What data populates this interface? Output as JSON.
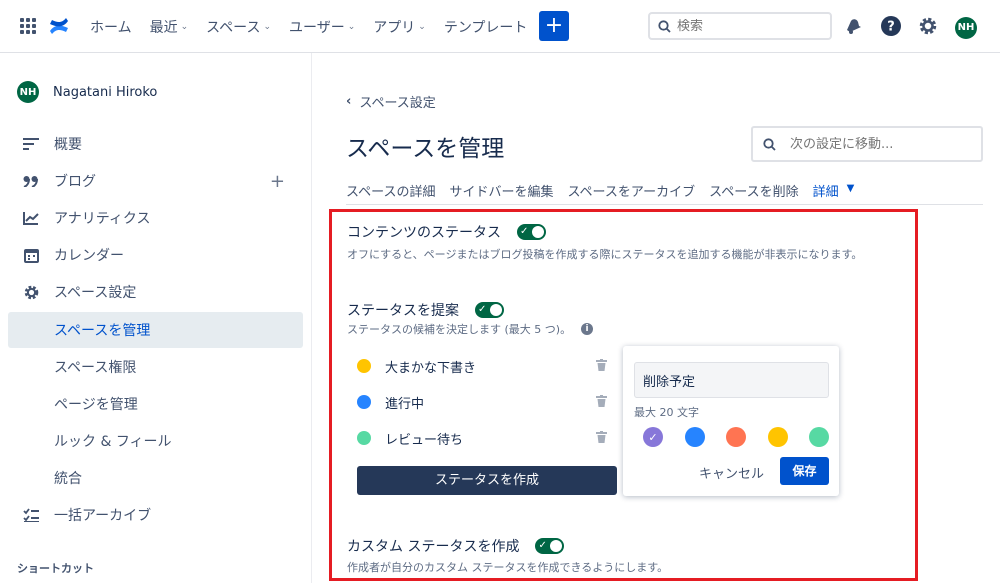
{
  "topnav": {
    "items": [
      {
        "label": "ホーム",
        "dropdown": false
      },
      {
        "label": "最近",
        "dropdown": true
      },
      {
        "label": "スペース",
        "dropdown": true
      },
      {
        "label": "ユーザー",
        "dropdown": true
      },
      {
        "label": "アプリ",
        "dropdown": true
      },
      {
        "label": "テンプレート",
        "dropdown": false
      }
    ],
    "create_label": "+",
    "search_placeholder": "検索",
    "avatar_initials": "NH",
    "brand_color": "#0052cc"
  },
  "sidebar": {
    "user": {
      "initials": "NH",
      "name": "Nagatani Hiroko"
    },
    "items": [
      {
        "label": "概要",
        "icon": "list-icon"
      },
      {
        "label": "ブログ",
        "icon": "quote-icon"
      },
      {
        "label": "アナリティクス",
        "icon": "chart-icon"
      },
      {
        "label": "カレンダー",
        "icon": "calendar-icon"
      },
      {
        "label": "スペース設定",
        "icon": "gear-icon"
      }
    ],
    "sub_items": [
      {
        "label": "スペースを管理",
        "active": true
      },
      {
        "label": "スペース権限",
        "active": false
      },
      {
        "label": "ページを管理",
        "active": false
      },
      {
        "label": "ルック & フィール",
        "active": false
      },
      {
        "label": "統合",
        "active": false
      }
    ],
    "archive_label": "一括アーカイブ",
    "shortcut_heading": "ショートカット"
  },
  "main": {
    "breadcrumb": "スペース設定",
    "title": "スペースを管理",
    "goto_placeholder": "次の設定に移動...",
    "tabs": [
      "スペースの詳細",
      "サイドバーを編集",
      "スペースをアーカイブ",
      "スペースを削除"
    ],
    "more_tab": "詳細",
    "content_status": {
      "title": "コンテンツのステータス",
      "enabled": true,
      "description": "オフにすると、ページまたはブログ投稿を作成する際にステータスを追加する機能が非表示になります。"
    },
    "suggest_status": {
      "title": "ステータスを提案",
      "enabled": true,
      "description": "ステータスの候補を決定します (最大 5 つ)。",
      "info": "i"
    },
    "statuses": [
      {
        "label": "大まかな下書き",
        "color": "#ffc400"
      },
      {
        "label": "進行中",
        "color": "#2684ff"
      },
      {
        "label": "レビュー待ち",
        "color": "#57d9a3"
      }
    ],
    "create_status_label": "ステータスを作成",
    "custom_status": {
      "title": "カスタム ステータスを作成",
      "enabled": true,
      "description": "作成者が自分のカスタム ステータスを作成できるようにします。"
    }
  },
  "popup": {
    "input_value": "削除予定",
    "hint": "最大 20 文字",
    "swatches": [
      {
        "color": "#8777d9",
        "selected": true
      },
      {
        "color": "#2684ff",
        "selected": false
      },
      {
        "color": "#ff7452",
        "selected": false
      },
      {
        "color": "#ffc400",
        "selected": false
      },
      {
        "color": "#57d9a3",
        "selected": false
      }
    ],
    "cancel_label": "キャンセル",
    "save_label": "保存"
  },
  "highlight_color": "#e51c23"
}
